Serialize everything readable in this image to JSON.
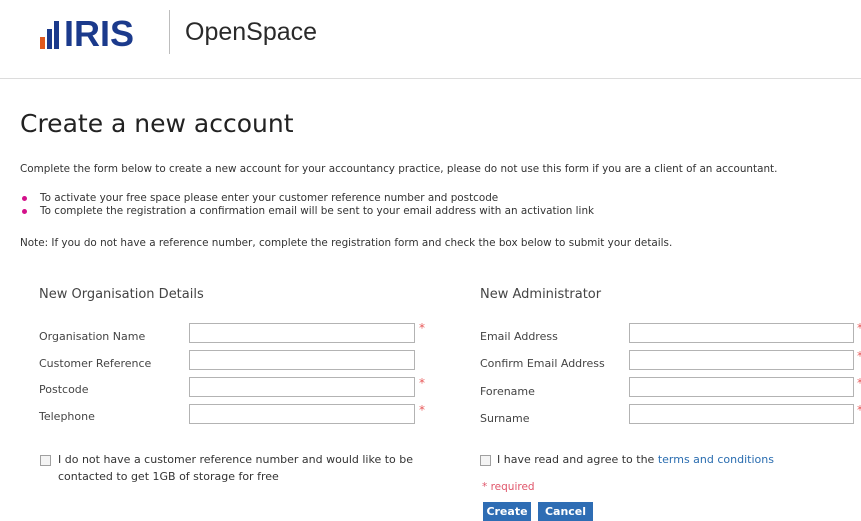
{
  "header": {
    "logo_text": "IRIS",
    "product_name": "OpenSpace"
  },
  "page": {
    "title": "Create a new account",
    "intro": "Complete the form below to create a new account for your accountancy practice, please do not use this form if you are a client of an accountant.",
    "bullets": [
      "To activate your free space please enter your customer reference number and postcode",
      "To complete the registration a confirmation email will be sent to your email address with an activation link"
    ],
    "note": "Note: If you do not have a reference number, complete the registration form and check the box below to submit your details."
  },
  "organisation": {
    "title": "New Organisation Details",
    "fields": [
      {
        "label": "Organisation Name",
        "value": "",
        "required": "*"
      },
      {
        "label": "Customer Reference",
        "value": "",
        "required": ""
      },
      {
        "label": "Postcode",
        "value": "",
        "required": "*"
      },
      {
        "label": "Telephone",
        "value": "",
        "required": "*"
      }
    ],
    "no_reference_checkbox": "I do not have a customer reference number and would like to be contacted to get 1GB of storage for free"
  },
  "administrator": {
    "title": "New Administrator",
    "fields": [
      {
        "label": "Email Address",
        "value": "",
        "required": "*"
      },
      {
        "label": "Confirm Email Address",
        "value": "",
        "required": "*"
      },
      {
        "label": "Forename",
        "value": "",
        "required": "*"
      },
      {
        "label": "Surname",
        "value": "",
        "required": "*"
      }
    ],
    "terms_prefix": "I have read and agree to the",
    "terms_link": "terms and conditions",
    "required_note": "* required",
    "create_label": "Create",
    "cancel_label": "Cancel"
  },
  "colors": {
    "brand_blue": "#1b3a8c",
    "brand_orange": "#e05a1e",
    "bullet_pink": "#d3118a",
    "button_blue": "#2e6db4",
    "required_red": "#e85a5a"
  }
}
